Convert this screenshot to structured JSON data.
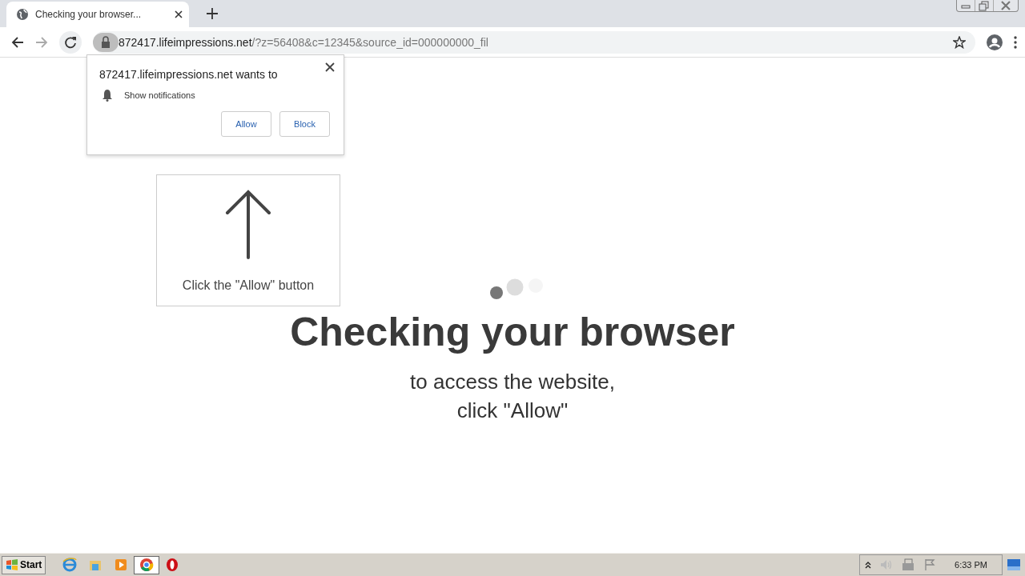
{
  "browser": {
    "tabs": [
      {
        "title": "Checking your browser...",
        "selected": true
      }
    ],
    "address": {
      "host": "872417.lifeimpressions.net",
      "path": "/?z=56408&c=12345&source_id=000000000_fil"
    }
  },
  "permission_popup": {
    "title": "872417.lifeimpressions.net wants to",
    "permission": "Show notifications",
    "buttons": [
      {
        "label": "Allow"
      },
      {
        "label": "Block"
      }
    ]
  },
  "hint_card": {
    "text": "Click the \"Allow\" button"
  },
  "page": {
    "heading": "Checking your browser",
    "lines": [
      "to access the website,",
      "click \"Allow\""
    ]
  },
  "taskbar": {
    "start": "Start",
    "apps": [
      {
        "kind": "ie",
        "selected": false
      },
      {
        "kind": "folder",
        "selected": false
      },
      {
        "kind": "media",
        "selected": false
      },
      {
        "kind": "chrome",
        "selected": true
      },
      {
        "kind": "opera",
        "selected": false
      }
    ],
    "clock": "6:33 PM"
  }
}
